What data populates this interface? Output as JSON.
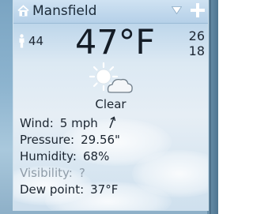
{
  "header": {
    "location": "Mansfield"
  },
  "current": {
    "temperature": "47°F",
    "feels_like": "44",
    "high": "26",
    "low": "18",
    "condition": "Clear",
    "icon": "sun-behind-cloud-icon"
  },
  "details": {
    "wind_label": "Wind:",
    "wind_value": "5 mph",
    "pressure_label": "Pressure:",
    "pressure_value": "29.56\"",
    "humidity_label": "Humidity:",
    "humidity_value": "68%",
    "visibility_label": "Visibility:",
    "visibility_value": "?",
    "dewpoint_label": "Dew point:",
    "dewpoint_value": "37°F"
  },
  "colors": {
    "text": "#1b2530",
    "dim_text": "#8f9ca8",
    "header_bg": "#b5d0e8"
  }
}
